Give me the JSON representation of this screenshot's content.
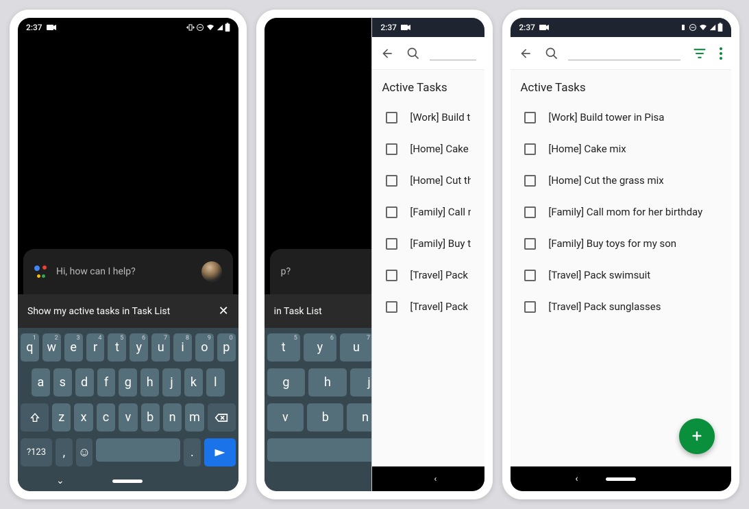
{
  "status": {
    "time": "2:37"
  },
  "assistant": {
    "prompt": "Hi, how can I help?"
  },
  "input": {
    "full": "Show my active tasks in Task List",
    "partial": "in Task List"
  },
  "keyboard": {
    "row1": [
      "q",
      "w",
      "e",
      "r",
      "t",
      "y",
      "u",
      "i",
      "o",
      "p"
    ],
    "nums": [
      "1",
      "2",
      "3",
      "4",
      "5",
      "6",
      "7",
      "8",
      "9",
      "0"
    ],
    "row2": [
      "a",
      "s",
      "d",
      "f",
      "g",
      "h",
      "j",
      "k",
      "l"
    ],
    "row3": [
      "z",
      "x",
      "c",
      "v",
      "b",
      "n",
      "m"
    ],
    "symkey": "?123",
    "comma": ",",
    "period": "."
  },
  "tasks": {
    "section": "Active Tasks",
    "items": [
      "[Work] Build tower in Pisa",
      "[Home] Cake mix",
      "[Home] Cut the grass mix",
      "[Family] Call mom for her birthday",
      "[Family] Buy toys for my son",
      "[Travel] Pack swimsuit",
      "[Travel] Pack sunglasses"
    ],
    "items_clip": [
      "[Work] Build t",
      "[Home] Cake",
      "[Home] Cut th",
      "[Family] Call m",
      "[Family] Buy t",
      "[Travel] Pack s",
      "[Travel] Pack s"
    ]
  }
}
